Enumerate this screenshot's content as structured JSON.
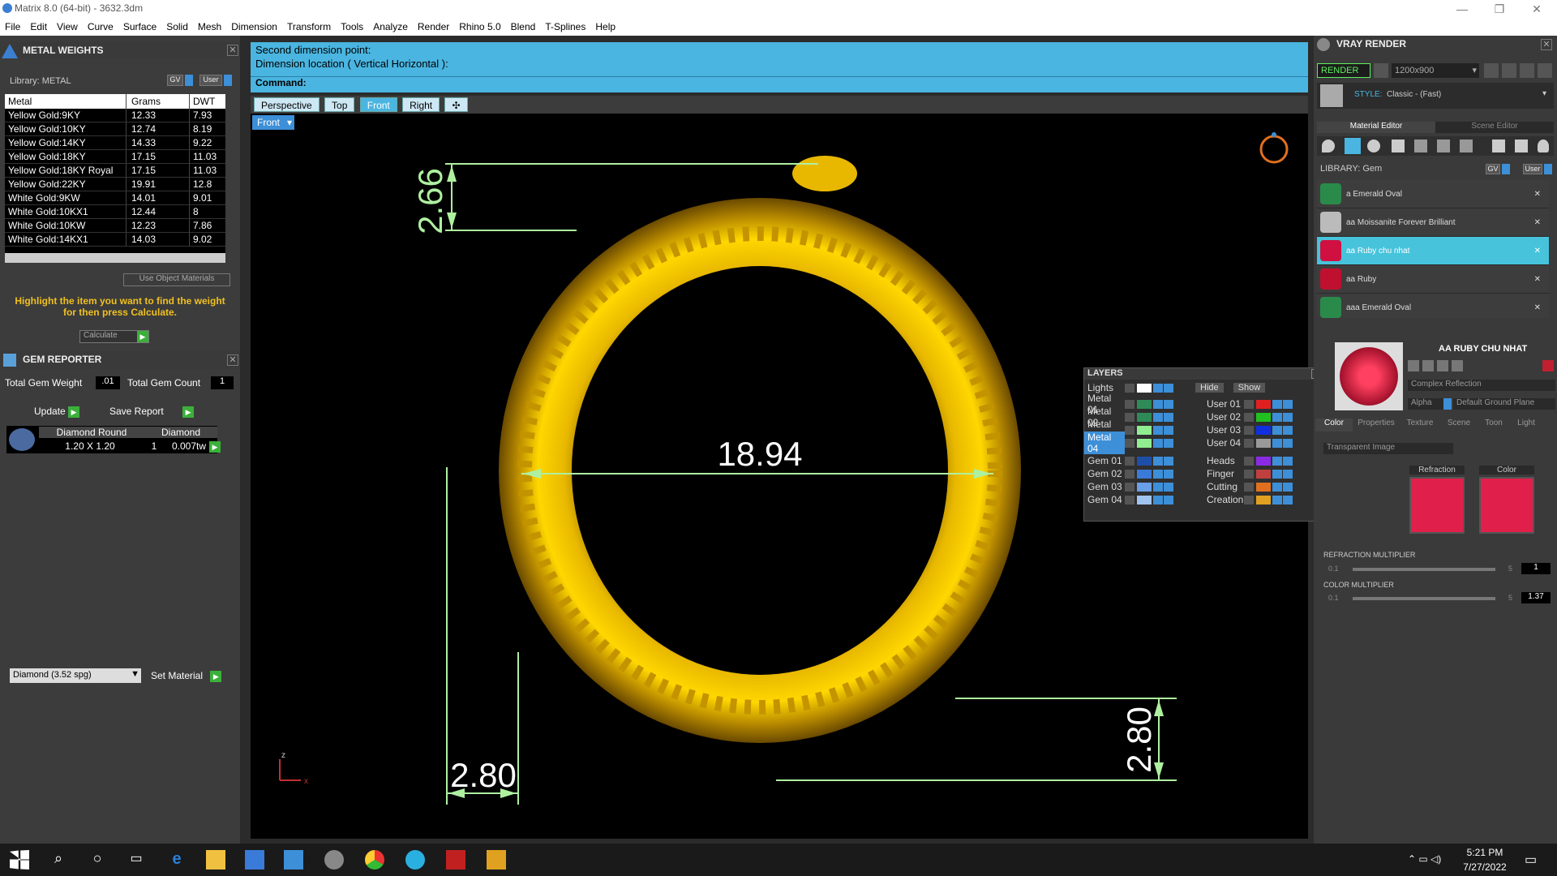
{
  "window": {
    "title": "Matrix 8.0 (64-bit) - 3632.3dm"
  },
  "menu": [
    "File",
    "Edit",
    "View",
    "Curve",
    "Surface",
    "Solid",
    "Mesh",
    "Dimension",
    "Transform",
    "Tools",
    "Analyze",
    "Render",
    "Rhino 5.0",
    "Blend",
    "T-Splines",
    "Help"
  ],
  "metal_weights": {
    "title": "METAL WEIGHTS",
    "library_label": "Library: METAL",
    "toggle_gv": "GV",
    "toggle_user": "User",
    "columns": [
      "Metal",
      "Grams",
      "DWT"
    ],
    "rows": [
      [
        "Yellow Gold:9KY",
        "12.33",
        "7.93"
      ],
      [
        "Yellow Gold:10KY",
        "12.74",
        "8.19"
      ],
      [
        "Yellow Gold:14KY",
        "14.33",
        "9.22"
      ],
      [
        "Yellow Gold:18KY",
        "17.15",
        "11.03"
      ],
      [
        "Yellow Gold:18KY Royal",
        "17.15",
        "11.03"
      ],
      [
        "Yellow Gold:22KY",
        "19.91",
        "12.8"
      ],
      [
        "White Gold:9KW",
        "14.01",
        "9.01"
      ],
      [
        "White Gold:10KX1",
        "12.44",
        "8"
      ],
      [
        "White Gold:10KW",
        "12.23",
        "7.86"
      ],
      [
        "White Gold:14KX1",
        "14.03",
        "9.02"
      ]
    ],
    "use_object_materials": "Use Object Materials",
    "hint": "Highlight the item you want to find the weight for then press Calculate.",
    "calculate": "Calculate"
  },
  "gem_reporter": {
    "title": "GEM REPORTER",
    "total_weight_label": "Total Gem Weight",
    "total_weight": ".01",
    "total_count_label": "Total Gem Count",
    "total_count": "1",
    "update": "Update",
    "save_report": "Save Report",
    "col_type": "Diamond Round",
    "col_material": "Diamond",
    "size": "1.20 X 1.20",
    "count": "1",
    "weight": "0.007tw",
    "material_select": "Diamond    (3.52 spg)",
    "set_material": "Set Material"
  },
  "command": {
    "line1": "Second dimension point:",
    "line2": "Dimension location ( Vertical  Horizontal ):",
    "prompt": "Command:"
  },
  "viewport_tabs": [
    "Perspective",
    "Top",
    "Front",
    "Right"
  ],
  "active_view": "Front",
  "view_label": "Front",
  "dimensions": {
    "top": "2.66",
    "diameter": "18.94",
    "bottom_left": "2.80",
    "bottom_right": "2.80"
  },
  "axis": {
    "z": "z",
    "x": "x"
  },
  "layers": {
    "title": "LAYERS",
    "lights": "Lights",
    "hide": "Hide",
    "show": "Show",
    "left": [
      {
        "name": "Metal 01",
        "color": "#2e8b57"
      },
      {
        "name": "Metal 02",
        "color": "#2e8b57"
      },
      {
        "name": "Metal 03",
        "color": "#90ee90"
      },
      {
        "name": "Metal 04",
        "color": "#90ee90"
      },
      {
        "name": "Gem 01",
        "color": "#1e4fa8"
      },
      {
        "name": "Gem 02",
        "color": "#3a7ad8"
      },
      {
        "name": "Gem 03",
        "color": "#6aa0e8"
      },
      {
        "name": "Gem 04",
        "color": "#a0c4f0"
      }
    ],
    "right": [
      {
        "name": "User 01",
        "color": "#e02020"
      },
      {
        "name": "User 02",
        "color": "#20c020"
      },
      {
        "name": "User 03",
        "color": "#1030e0"
      },
      {
        "name": "User 04",
        "color": "#999999"
      },
      {
        "name": "Heads",
        "color": "#8a2be2"
      },
      {
        "name": "Finger",
        "color": "#c04040"
      },
      {
        "name": "Cutting",
        "color": "#e07020"
      },
      {
        "name": "Creation",
        "color": "#e0a020"
      }
    ]
  },
  "vray": {
    "title": "VRAY RENDER",
    "render": "RENDER",
    "resolution": "1200x900",
    "style_label": "STYLE:",
    "style": "Classic - (Fast)",
    "tab_material": "Material Editor",
    "tab_scene": "Scene Editor",
    "library_label": "LIBRARY: Gem",
    "gv": "GV",
    "user": "User",
    "items": [
      "a Emerald Oval",
      "aa Moissanite Forever Brilliant",
      "aa Ruby chu nhat",
      "aa Ruby",
      "aaa Emerald Oval"
    ],
    "selected_index": 2,
    "material_name": "AA RUBY CHU NHAT",
    "reflection": "Complex Reflection",
    "alpha": "Alpha",
    "ground": "Default Ground Plane",
    "subtabs": [
      "Color",
      "Properties",
      "Texture",
      "Scene",
      "Toon",
      "Light"
    ],
    "transparent": "Transparent Image",
    "refraction_label": "Refraction",
    "color_label": "Color",
    "refraction_multiplier": "REFRACTION MULTIPLIER",
    "refraction_min": "0.1",
    "refraction_max": "5",
    "refraction_value": "1",
    "color_multiplier": "COLOR MULTIPLIER",
    "color_min": "0.1",
    "color_max": "5",
    "color_value": "1.37"
  },
  "taskbar": {
    "time": "5:21 PM",
    "date": "7/27/2022"
  }
}
